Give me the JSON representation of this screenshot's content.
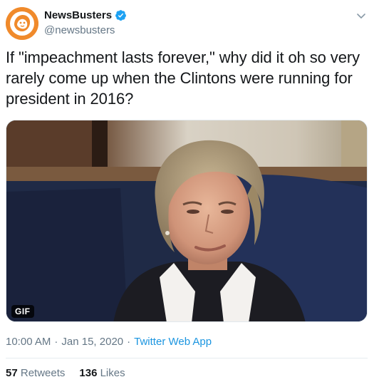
{
  "tweet": {
    "display_name": "NewsBusters",
    "handle": "@newsbusters",
    "verified_icon": "verified-badge-icon",
    "text": "If \"impeachment lasts forever,\" why did it oh so very rarely come up when the Clintons were running for president in 2016?",
    "media": {
      "badge": "GIF"
    },
    "time": "10:00 AM",
    "date": "Jan 15, 2020",
    "source": "Twitter Web App",
    "retweets_count": "57",
    "retweets_label": "Retweets",
    "likes_count": "136",
    "likes_label": "Likes"
  },
  "colors": {
    "link": "#1b95e0",
    "verified": "#1da1f2",
    "avatar_bg": "#f08a2b",
    "muted": "#657786"
  }
}
